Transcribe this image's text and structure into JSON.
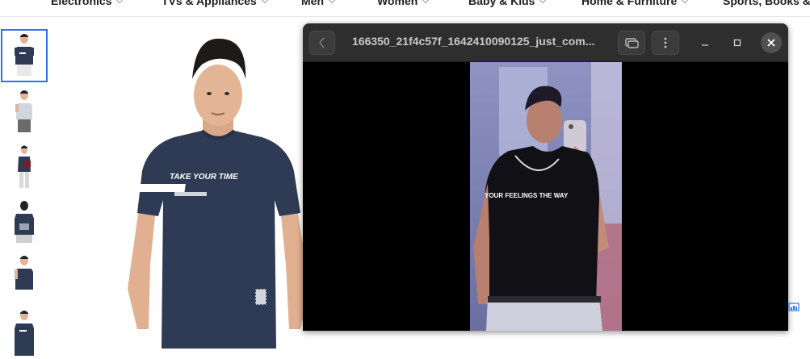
{
  "nav": {
    "categories": [
      {
        "label": "Electronics"
      },
      {
        "label": "TVs & Appliances"
      },
      {
        "label": "Men"
      },
      {
        "label": "Women"
      },
      {
        "label": "Baby & Kids"
      },
      {
        "label": "Home & Furniture"
      },
      {
        "label": "Sports, Books & M"
      }
    ]
  },
  "product": {
    "thumbnail_count": 6,
    "selected_thumbnail": 1,
    "tshirt_print_text": "TAKE YOUR  TIME"
  },
  "video_window": {
    "title": "166350_21f4c57f_1642410090125_just_com...",
    "caption_text": "YOUR FEELINGS THE WAY"
  },
  "colors": {
    "accent": "#2874f0",
    "window_titlebar": "#2e2e2e",
    "shirt_navy": "#2f3b55"
  }
}
